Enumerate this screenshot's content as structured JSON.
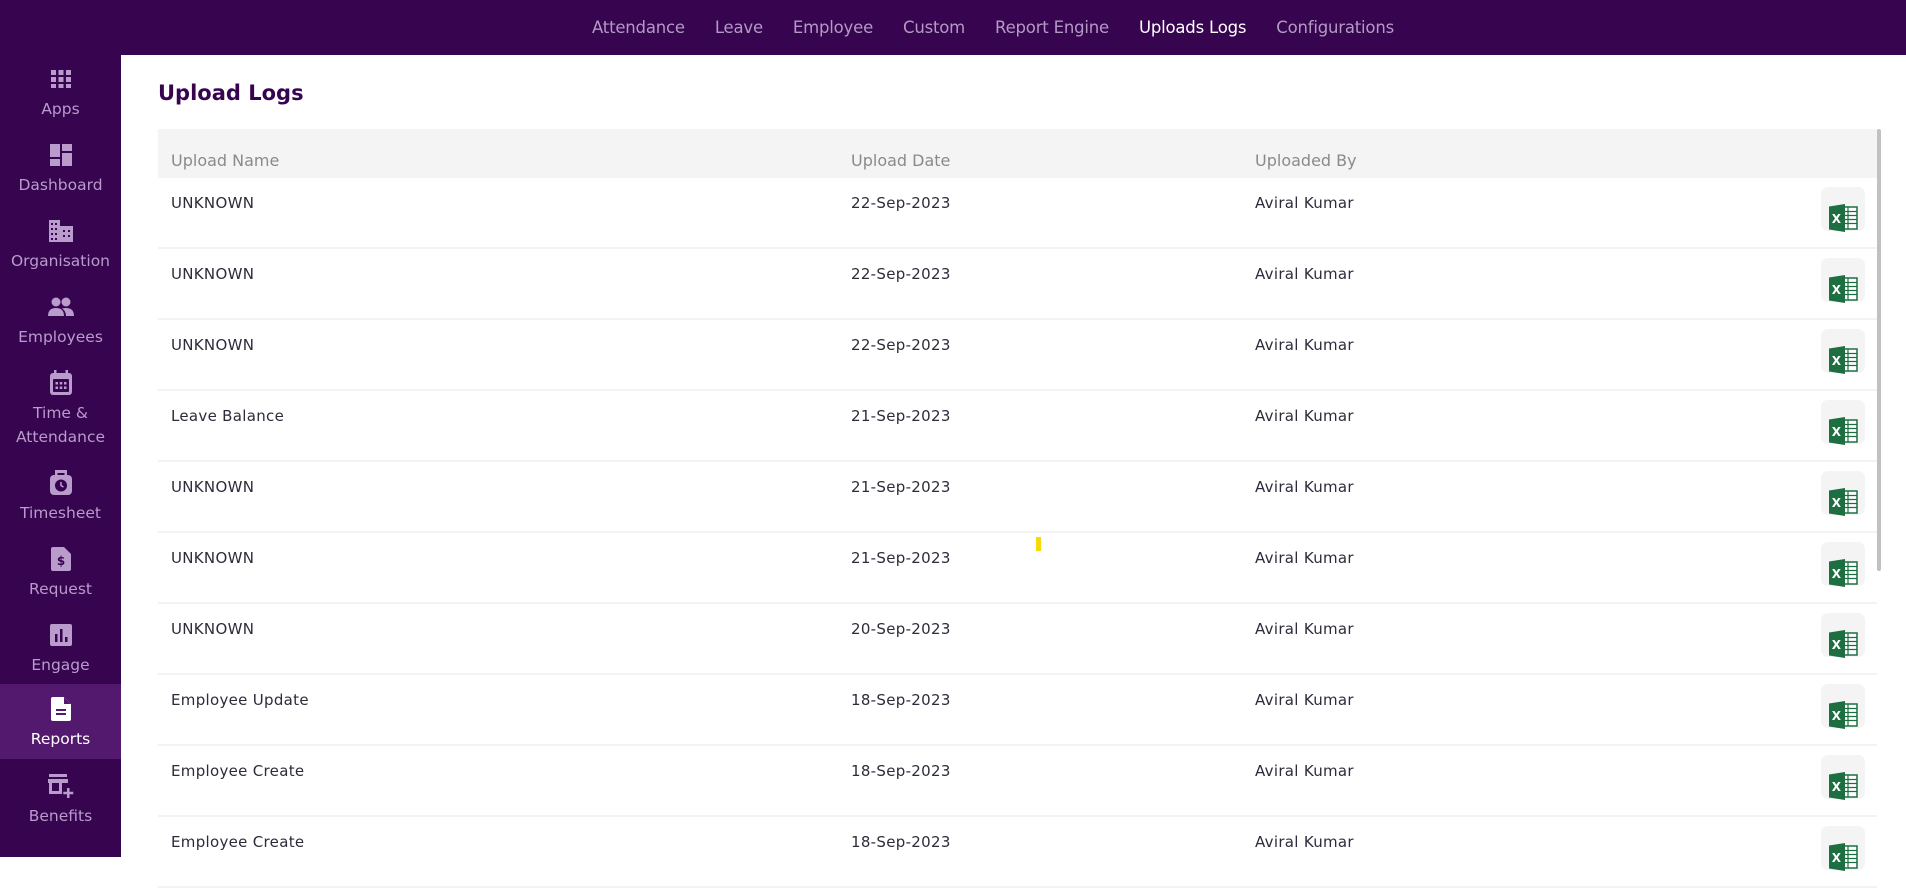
{
  "topnav": {
    "items": [
      {
        "label": "Attendance",
        "active": false
      },
      {
        "label": "Leave",
        "active": false
      },
      {
        "label": "Employee",
        "active": false
      },
      {
        "label": "Custom",
        "active": false
      },
      {
        "label": "Report Engine",
        "active": false
      },
      {
        "label": "Uploads Logs",
        "active": true
      },
      {
        "label": "Configurations",
        "active": false
      }
    ]
  },
  "sidebar": {
    "items": [
      {
        "label": "Apps",
        "icon": "apps-grid-icon"
      },
      {
        "label": "Dashboard",
        "icon": "dashboard-icon"
      },
      {
        "label": "Organisation",
        "icon": "building-icon"
      },
      {
        "label": "Employees",
        "icon": "people-icon"
      },
      {
        "label": "Time & Attendance",
        "icon": "calendar-icon"
      },
      {
        "label": "Timesheet",
        "icon": "timesheet-clock-icon"
      },
      {
        "label": "Request",
        "icon": "request-dollar-icon"
      },
      {
        "label": "Engage",
        "icon": "bar-chart-icon"
      },
      {
        "label": "Reports",
        "icon": "report-document-icon",
        "active": true
      },
      {
        "label": "Benefits",
        "icon": "store-plus-icon"
      }
    ]
  },
  "page": {
    "title": "Upload Logs"
  },
  "table": {
    "columns": [
      "Upload Name",
      "Upload Date",
      "Uploaded By"
    ],
    "rows": [
      {
        "name": "UNKNOWN",
        "date": "22-Sep-2023",
        "by": "Aviral Kumar"
      },
      {
        "name": "UNKNOWN",
        "date": "22-Sep-2023",
        "by": "Aviral Kumar"
      },
      {
        "name": "UNKNOWN",
        "date": "22-Sep-2023",
        "by": "Aviral Kumar"
      },
      {
        "name": "Leave Balance",
        "date": "21-Sep-2023",
        "by": "Aviral Kumar"
      },
      {
        "name": "UNKNOWN",
        "date": "21-Sep-2023",
        "by": "Aviral Kumar"
      },
      {
        "name": "UNKNOWN",
        "date": "21-Sep-2023",
        "by": "Aviral Kumar"
      },
      {
        "name": "UNKNOWN",
        "date": "20-Sep-2023",
        "by": "Aviral Kumar"
      },
      {
        "name": "Employee Update",
        "date": "18-Sep-2023",
        "by": "Aviral Kumar"
      },
      {
        "name": "Employee Create",
        "date": "18-Sep-2023",
        "by": "Aviral Kumar"
      },
      {
        "name": "Employee Create",
        "date": "18-Sep-2023",
        "by": "Aviral Kumar"
      }
    ],
    "row_action_icon": "excel-download-icon"
  },
  "colors": {
    "brand": "#370450",
    "sidebar_active": "#53196e",
    "excel_green": "#1d6f42"
  }
}
